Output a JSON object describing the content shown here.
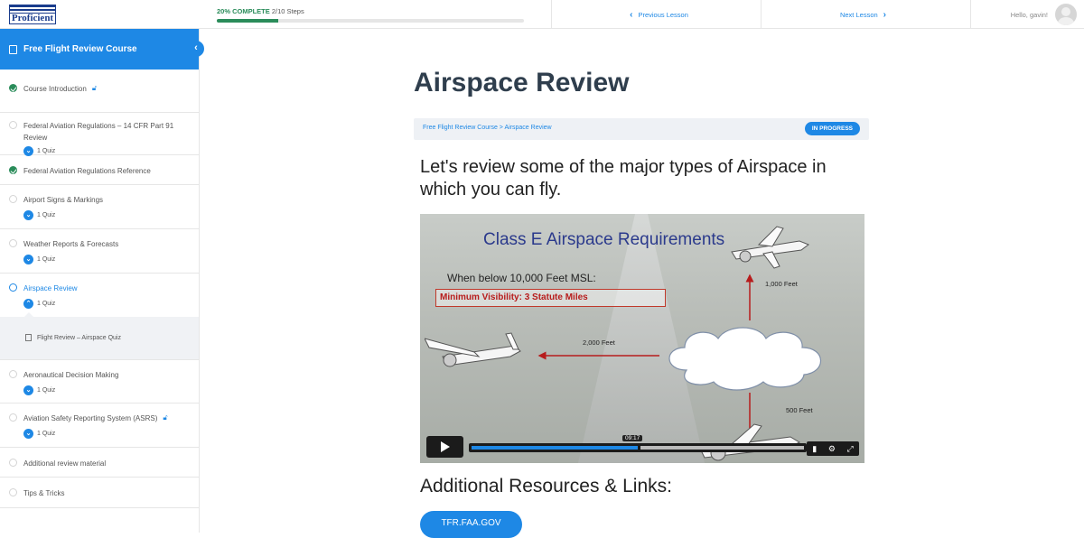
{
  "topbar": {
    "logo_text": "Proficient",
    "progress_percent": "20% COMPLETE",
    "progress_steps": "2/10 Steps",
    "progress_fraction": 0.2,
    "prev_label": "Previous Lesson",
    "next_label": "Next Lesson",
    "greeting": "Hello, gavin!"
  },
  "sidebar": {
    "course_title": "Free Flight Review Course",
    "lessons": [
      {
        "title": "Course Introduction",
        "status": "complete",
        "locked": true
      },
      {
        "title": "Federal Aviation Regulations – 14 CFR Part 91 Review",
        "status": "incomplete",
        "quiz": "1 Quiz"
      },
      {
        "title": "Federal Aviation Regulations Reference",
        "status": "complete"
      },
      {
        "title": "Airport Signs & Markings",
        "status": "incomplete",
        "quiz": "1 Quiz"
      },
      {
        "title": "Weather Reports & Forecasts",
        "status": "incomplete",
        "quiz": "1 Quiz"
      },
      {
        "title": "Airspace Review",
        "status": "current",
        "quiz": "1 Quiz",
        "sub_item": "Flight Review – Airspace Quiz"
      },
      {
        "title": "Aeronautical Decision Making",
        "status": "incomplete",
        "quiz": "1 Quiz"
      },
      {
        "title": "Aviation Safety Reporting System (ASRS)",
        "status": "incomplete",
        "locked": true,
        "quiz": "1 Quiz"
      },
      {
        "title": "Additional review material",
        "status": "incomplete"
      },
      {
        "title": "Tips & Tricks",
        "status": "incomplete"
      }
    ]
  },
  "main": {
    "title": "Airspace Review",
    "breadcrumb": "Free Flight Review Course > Airspace Review",
    "status_badge": "IN PROGRESS",
    "intro": "Let's review some of the major types of Airspace in which you can fly.",
    "video": {
      "slide_title": "Class E Airspace Requirements",
      "slide_subtitle": "When below 10,000 Feet MSL:",
      "slide_box": "Minimum Visibility: 3 Statute Miles",
      "label_up": "1,000 Feet",
      "label_left": "2,000 Feet",
      "label_down": "500 Feet",
      "timecode": "09:17",
      "played_fraction": 0.5
    },
    "resources_title": "Additional Resources & Links:",
    "resource_button": "TFR.FAA.GOV"
  },
  "colors": {
    "accent": "#1e88e5",
    "complete": "#2a8c5a",
    "title": "#2f3e4d"
  }
}
